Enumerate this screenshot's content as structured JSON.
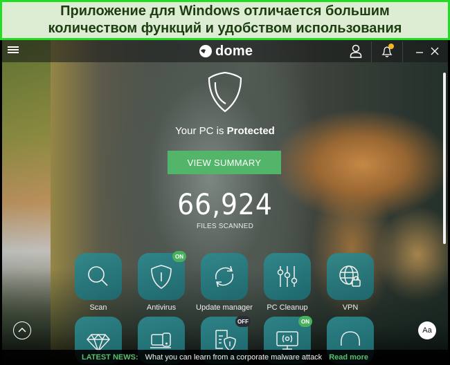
{
  "banner": {
    "line1": "Приложение для Windows отличается большим",
    "line2": "количеством функций и удобством использования"
  },
  "titlebar": {
    "app_name": "dome",
    "icons": [
      "menu-icon",
      "user-icon",
      "bell-icon",
      "minimize-icon",
      "close-icon"
    ],
    "notification_color": "#f4b522"
  },
  "status": {
    "prefix": "Your PC is ",
    "state": "Protected",
    "button_label": "VIEW SUMMARY",
    "files_count": "66,924",
    "files_label": "FILES SCANNED"
  },
  "features": [
    {
      "label": "Scan",
      "icon": "search-icon"
    },
    {
      "label": "Antivirus",
      "icon": "shield-icon",
      "badge": "ON"
    },
    {
      "label": "Update manager",
      "icon": "refresh-icon"
    },
    {
      "label": "PC Cleanup",
      "icon": "sliders-icon"
    },
    {
      "label": "VPN",
      "icon": "globe-lock-icon"
    },
    {
      "label": "",
      "icon": "diamond-icon"
    },
    {
      "label": "",
      "icon": "devices-icon"
    },
    {
      "label": "",
      "icon": "document-shield-icon",
      "badge": "OFF"
    },
    {
      "label": "",
      "icon": "monitor-wifi-icon",
      "badge": "ON"
    },
    {
      "label": "",
      "icon": "headset-icon"
    }
  ],
  "controls": {
    "font_button": "Aa"
  },
  "news": {
    "label": "LATEST NEWS:",
    "text": "What you can learn from a corporate malware attack",
    "link": "Read more"
  },
  "colors": {
    "accent_green": "#52b569",
    "tile_teal": "#2e8a8e",
    "banner_border": "#22dd22",
    "banner_bg": "#dcedd3"
  }
}
